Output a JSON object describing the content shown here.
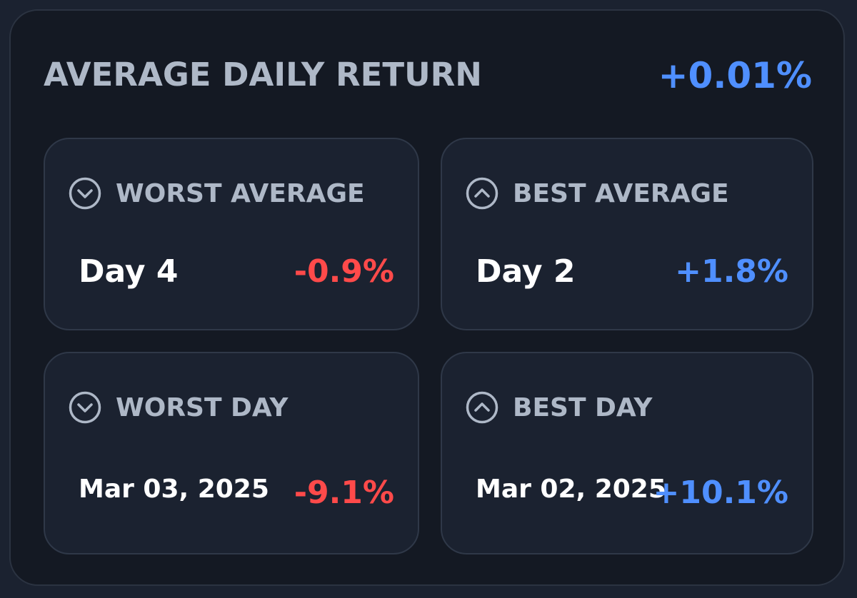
{
  "panel": {
    "title": "AVERAGE DAILY RETURN",
    "total_return": "+0.01%"
  },
  "cards": {
    "worst_average": {
      "label": "WORST AVERAGE",
      "subject": "Day 4",
      "value": "-0.9%",
      "icon": "chevron-down-circle-icon"
    },
    "best_average": {
      "label": "BEST AVERAGE",
      "subject": "Day 2",
      "value": "+1.8%",
      "icon": "chevron-up-circle-icon"
    },
    "worst_day": {
      "label": "WORST DAY",
      "subject": "Mar 03, 2025",
      "value": "-9.1%",
      "icon": "chevron-down-circle-icon"
    },
    "best_day": {
      "label": "BEST DAY",
      "subject": "Mar 02, 2025",
      "value": "+10.1%",
      "icon": "chevron-up-circle-icon"
    }
  },
  "colors": {
    "positive": "#4f8fff",
    "negative": "#ff4a4a",
    "label": "#aeb8c7",
    "text": "#ffffff"
  }
}
